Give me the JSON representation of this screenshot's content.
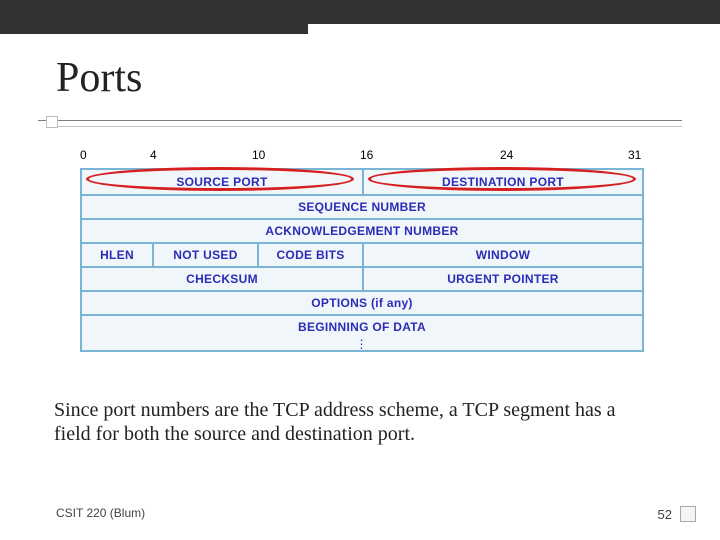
{
  "title": "Ports",
  "bit_labels": {
    "b0": "0",
    "b4": "4",
    "b10": "10",
    "b16": "16",
    "b24": "24",
    "b31": "31"
  },
  "tcp_header": {
    "row1": {
      "source_port": "SOURCE PORT",
      "dest_port": "DESTINATION PORT"
    },
    "row2": {
      "sequence": "SEQUENCE NUMBER"
    },
    "row3": {
      "ack": "ACKNOWLEDGEMENT NUMBER"
    },
    "row4": {
      "hlen": "HLEN",
      "not_used": "NOT USED",
      "code_bits": "CODE BITS",
      "window": "WINDOW"
    },
    "row5": {
      "checksum": "CHECKSUM",
      "urgent": "URGENT POINTER"
    },
    "row6": {
      "options": "OPTIONS (if any)"
    },
    "row7": {
      "data": "BEGINNING OF DATA"
    }
  },
  "caption": "Since port numbers are the TCP address scheme, a TCP segment has a field for both the source and destination port.",
  "footer": {
    "course": "CSIT 220 (Blum)",
    "page": "52"
  },
  "highlights": {
    "source_port": true,
    "dest_port": true
  }
}
